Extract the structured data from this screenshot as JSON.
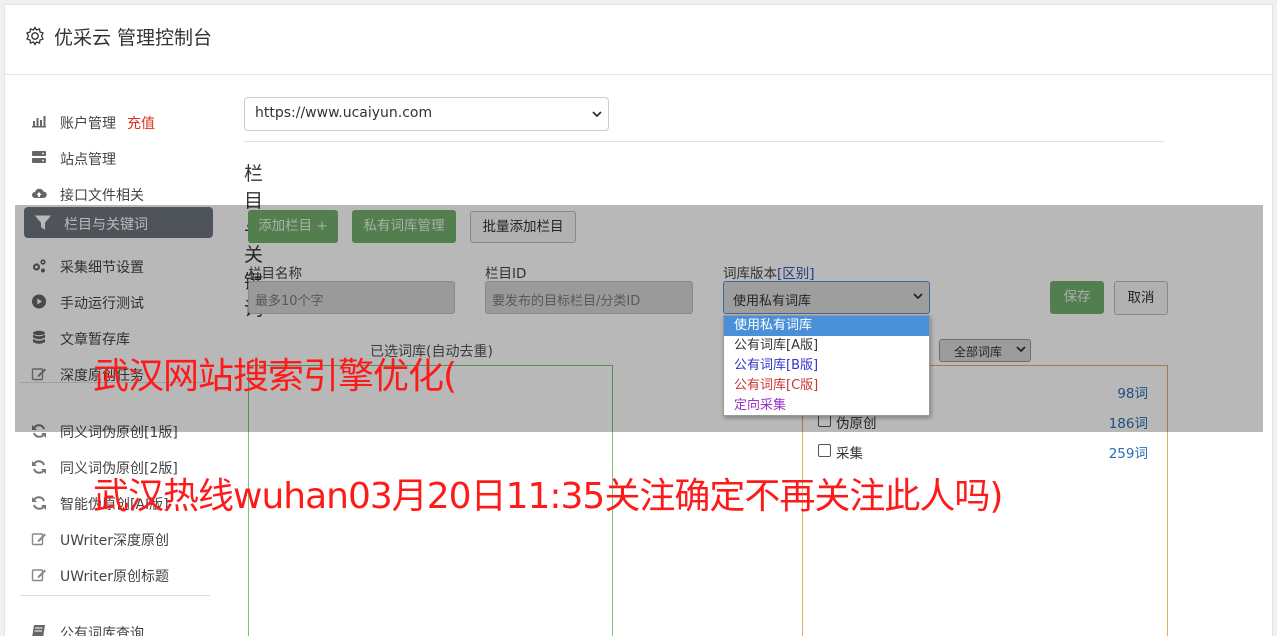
{
  "header": {
    "title": "优采云 管理控制台"
  },
  "sidebar": {
    "items": [
      {
        "label": "账户管理",
        "extra": "充值",
        "icon": "bar-chart-icon"
      },
      {
        "label": "站点管理",
        "icon": "server-icon"
      },
      {
        "label": "接口文件相关",
        "icon": "cloud-upload-icon"
      },
      {
        "label": "栏目与关键词",
        "icon": "filter-icon",
        "active": true
      },
      {
        "label": "采集细节设置",
        "icon": "cogs-icon"
      },
      {
        "label": "手动运行测试",
        "icon": "play-icon"
      },
      {
        "label": "文章暂存库",
        "icon": "database-icon"
      },
      {
        "label": "深度原创任务",
        "icon": "edit-icon"
      },
      {
        "label": "同义词伪原创[1版]",
        "icon": "refresh-icon"
      },
      {
        "label": "同义词伪原创[2版]",
        "icon": "refresh-icon"
      },
      {
        "label": "智能伪原创[AI版]",
        "icon": "refresh-icon"
      },
      {
        "label": "UWriter深度原创",
        "icon": "edit-icon"
      },
      {
        "label": "UWriter原创标题",
        "icon": "edit-icon"
      },
      {
        "label": "公有词库查询",
        "icon": "book-icon"
      }
    ]
  },
  "main": {
    "site_select_value": "https://www.ucaiyun.com",
    "section_title": "栏目与关键词",
    "buttons": {
      "add_column": "添加栏目 +",
      "private_lib": "私有词库管理",
      "batch_add": "批量添加栏目",
      "save": "保存",
      "cancel": "取消"
    },
    "form": {
      "column_name_label": "栏目名称",
      "column_name_placeholder": "最多10个字",
      "column_id_label": "栏目ID",
      "column_id_placeholder": "要发布的目标栏目/分类ID",
      "lib_version_label": "词库版本",
      "lib_version_link": "[区别]",
      "lib_version_value": "使用私有词库"
    },
    "dropdown_options": [
      {
        "label": "使用私有词库",
        "color": "#ffffff",
        "selected": true
      },
      {
        "label": "公有词库[A版]",
        "color": "#333333"
      },
      {
        "label": "公有词库[B版]",
        "color": "#3333cc"
      },
      {
        "label": "公有词库[C版]",
        "color": "#cc3333"
      },
      {
        "label": "定向采集",
        "color": "#9933cc"
      }
    ],
    "selected_words_title": "已选词库(自动去重)",
    "lib_filter_value": "全部词库",
    "lib_rows": [
      {
        "name": "",
        "count": "98词"
      },
      {
        "name": "伪原创",
        "count": "186词"
      },
      {
        "name": "采集",
        "count": "259词"
      }
    ]
  },
  "watermark": {
    "line1": "武汉网站搜索引擎优化(",
    "line2": "武汉热线wuhan03月20日11:35关注确定不再关注此人吗)"
  }
}
